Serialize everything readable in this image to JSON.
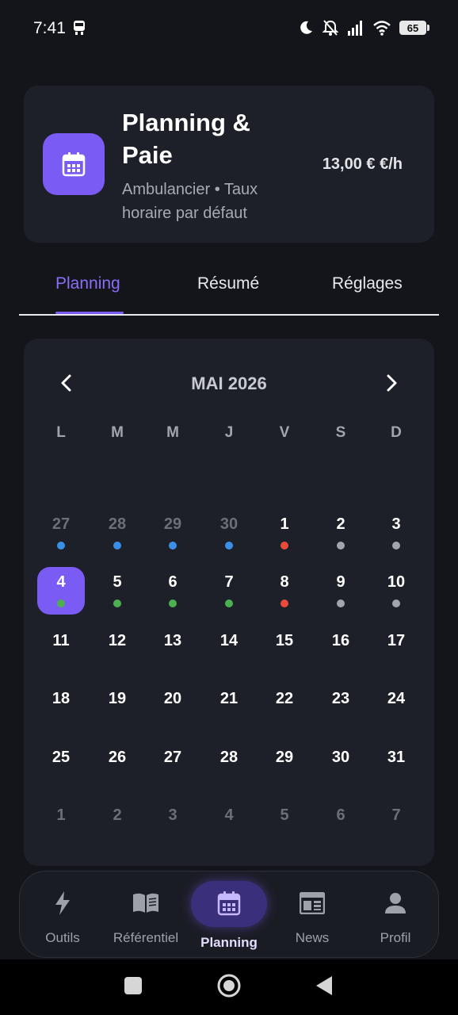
{
  "status_bar": {
    "time": "7:41",
    "battery": "65",
    "icons": [
      "train-icon",
      "moon-icon",
      "bell-off-icon",
      "signal-icon",
      "wifi-icon",
      "battery-icon"
    ]
  },
  "header": {
    "title": "Planning & Paie",
    "subtitle": "Ambulancier • Taux horaire par défaut",
    "rate": "13,00 € €/h",
    "icon": "calendar-icon",
    "accent_color": "#7a5cf5"
  },
  "tabs": [
    {
      "label": "Planning",
      "active": true
    },
    {
      "label": "Résumé",
      "active": false
    },
    {
      "label": "Réglages",
      "active": false
    }
  ],
  "calendar": {
    "month_label": "MAI 2026",
    "weekdays": [
      "L",
      "M",
      "M",
      "J",
      "V",
      "S",
      "D"
    ],
    "status_colors": {
      "blue": "#3b8fe8",
      "red": "#e84a3b",
      "gray": "#a3a5ad",
      "green": "#4caf50"
    },
    "weeks": [
      [
        {
          "n": "27",
          "muted": true,
          "dot": "blue"
        },
        {
          "n": "28",
          "muted": true,
          "dot": "blue"
        },
        {
          "n": "29",
          "muted": true,
          "dot": "blue"
        },
        {
          "n": "30",
          "muted": true,
          "dot": "blue"
        },
        {
          "n": "1",
          "dot": "red"
        },
        {
          "n": "2",
          "dot": "gray"
        },
        {
          "n": "3",
          "dot": "gray"
        }
      ],
      [
        {
          "n": "4",
          "dot": "green",
          "selected": true
        },
        {
          "n": "5",
          "dot": "green"
        },
        {
          "n": "6",
          "dot": "green"
        },
        {
          "n": "7",
          "dot": "green"
        },
        {
          "n": "8",
          "dot": "red"
        },
        {
          "n": "9",
          "dot": "gray"
        },
        {
          "n": "10",
          "dot": "gray"
        }
      ],
      [
        {
          "n": "11"
        },
        {
          "n": "12"
        },
        {
          "n": "13"
        },
        {
          "n": "14"
        },
        {
          "n": "15"
        },
        {
          "n": "16"
        },
        {
          "n": "17"
        }
      ],
      [
        {
          "n": "18"
        },
        {
          "n": "19"
        },
        {
          "n": "20"
        },
        {
          "n": "21"
        },
        {
          "n": "22"
        },
        {
          "n": "23"
        },
        {
          "n": "24"
        }
      ],
      [
        {
          "n": "25"
        },
        {
          "n": "26"
        },
        {
          "n": "27"
        },
        {
          "n": "28"
        },
        {
          "n": "29"
        },
        {
          "n": "30"
        },
        {
          "n": "31"
        }
      ],
      [
        {
          "n": "1",
          "muted": true
        },
        {
          "n": "2",
          "muted": true
        },
        {
          "n": "3",
          "muted": true
        },
        {
          "n": "4",
          "muted": true
        },
        {
          "n": "5",
          "muted": true
        },
        {
          "n": "6",
          "muted": true
        },
        {
          "n": "7",
          "muted": true
        }
      ]
    ]
  },
  "bottom_nav": [
    {
      "label": "Outils",
      "icon": "bolt-icon",
      "active": false
    },
    {
      "label": "Référentiel",
      "icon": "book-icon",
      "active": false
    },
    {
      "label": "Planning",
      "icon": "calendar-icon",
      "active": true
    },
    {
      "label": "News",
      "icon": "newspaper-icon",
      "active": false
    },
    {
      "label": "Profil",
      "icon": "person-icon",
      "active": false
    }
  ],
  "system_nav": {
    "icons": [
      "recents-square-icon",
      "home-circle-icon",
      "back-triangle-icon"
    ]
  }
}
